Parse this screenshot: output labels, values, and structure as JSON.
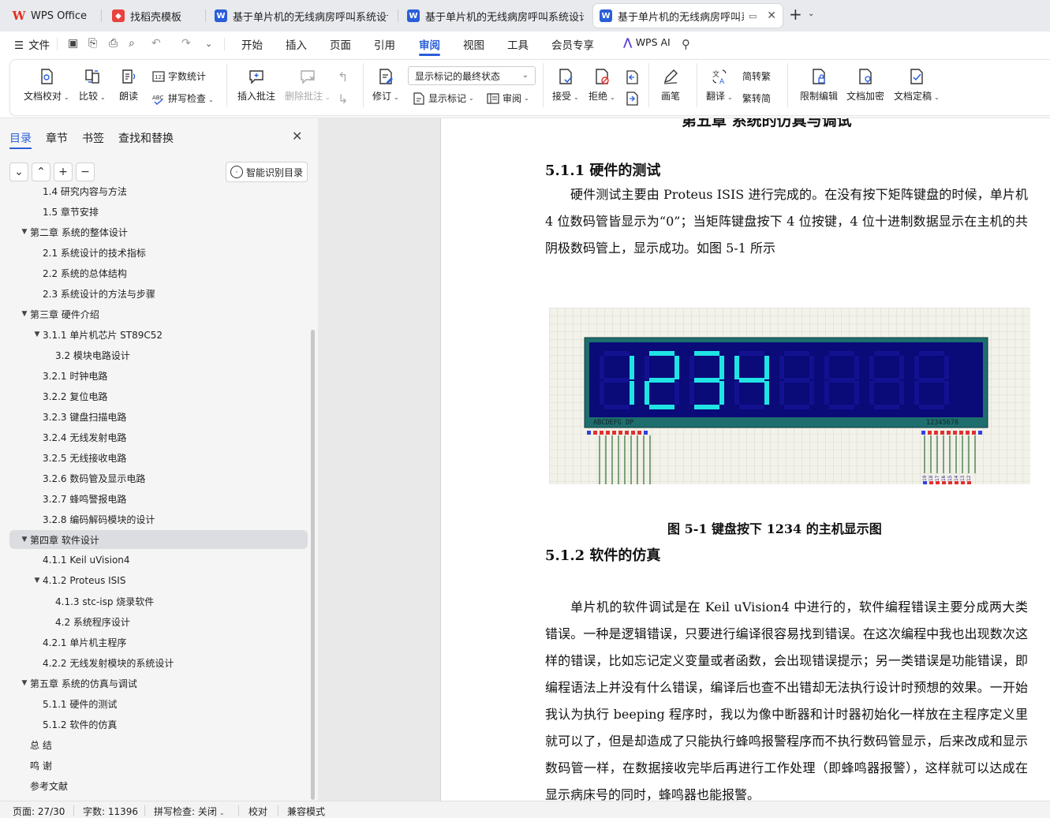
{
  "tabs": [
    {
      "label": "WPS Office",
      "icon": "wps-logo-icon"
    },
    {
      "label": "找稻壳模板",
      "icon": "docer-icon"
    },
    {
      "label": "基于单片机的无线病房呼叫系统设计（",
      "icon": "word-doc-icon"
    },
    {
      "label": "基于单片机的无线病房呼叫系统设计 3",
      "icon": "word-doc-icon"
    },
    {
      "label": "基于单片机的无线病房呼叫系统",
      "icon": "word-doc-icon"
    }
  ],
  "new_tab": "+",
  "menu": {
    "file": "文件",
    "items": [
      "开始",
      "插入",
      "页面",
      "引用",
      "审阅",
      "视图",
      "工具",
      "会员专享"
    ],
    "active": "审阅",
    "wps_ai": "WPS AI"
  },
  "ribbon": {
    "doc_proof": "文档校对",
    "compare": "比较",
    "read_aloud": "朗读",
    "word_count": "字数统计",
    "spell_check": "拼写检查",
    "insert_comment": "插入批注",
    "delete_comment": "删除批注",
    "track": "修订",
    "markup_state": "显示标记的最终状态",
    "show_markup": "显示标记",
    "review": "审阅",
    "accept": "接受",
    "reject": "拒绝",
    "pen": "画笔",
    "translate": "翻译",
    "to_traditional": "简转繁",
    "to_simplified": "繁转简",
    "restrict_edit": "限制编辑",
    "encrypt": "文档加密",
    "finalize": "文档定稿"
  },
  "nav": {
    "tabs": [
      "目录",
      "章节",
      "书签",
      "查找和替换"
    ],
    "smart_toc": "智能识别目录",
    "toc": [
      {
        "label": "1.4  研究内容与方法",
        "level": 2,
        "arrow": ""
      },
      {
        "label": "1.5  章节安排",
        "level": 2,
        "arrow": ""
      },
      {
        "label": "第二章  系统的整体设计",
        "level": 1,
        "arrow": "▼"
      },
      {
        "label": "2.1 系统设计的技术指标",
        "level": 2,
        "arrow": ""
      },
      {
        "label": "2.2 系统的总体结构",
        "level": 2,
        "arrow": ""
      },
      {
        "label": "2.3 系统设计的方法与步骤",
        "level": 2,
        "arrow": ""
      },
      {
        "label": "第三章  硬件介绍",
        "level": 1,
        "arrow": "▼"
      },
      {
        "label": "3.1.1 单片机芯片 ST89C52",
        "level": 2,
        "arrow": "▼"
      },
      {
        "label": "3.2 模块电路设计",
        "level": 3,
        "arrow": ""
      },
      {
        "label": "3.2.1  时钟电路",
        "level": 2,
        "arrow": ""
      },
      {
        "label": "3.2.2  复位电路",
        "level": 2,
        "arrow": ""
      },
      {
        "label": "3.2.3  键盘扫描电路",
        "level": 2,
        "arrow": ""
      },
      {
        "label": "3.2.4  无线发射电路",
        "level": 2,
        "arrow": ""
      },
      {
        "label": "3.2.5 无线接收电路",
        "level": 2,
        "arrow": ""
      },
      {
        "label": "3.2.6 数码管及显示电路",
        "level": 2,
        "arrow": ""
      },
      {
        "label": "3.2.7 蜂鸣警报电路",
        "level": 2,
        "arrow": ""
      },
      {
        "label": "3.2.8  编码解码模块的设计",
        "level": 2,
        "arrow": ""
      },
      {
        "label": "第四章    软件设计",
        "level": 1,
        "arrow": "▼",
        "selected": true
      },
      {
        "label": "4.1.1 Keil uVision4",
        "level": 2,
        "arrow": ""
      },
      {
        "label": "4.1.2 Proteus ISIS",
        "level": 2,
        "arrow": "▼"
      },
      {
        "label": "4.1.3 stc-isp 烧录软件",
        "level": 3,
        "arrow": ""
      },
      {
        "label": "4.2  系统程序设计",
        "level": 3,
        "arrow": ""
      },
      {
        "label": "4.2.1 单片机主程序",
        "level": 2,
        "arrow": ""
      },
      {
        "label": "4.2.2 无线发射模块的系统设计",
        "level": 2,
        "arrow": ""
      },
      {
        "label": "第五章  系统的仿真与调试",
        "level": 1,
        "arrow": "▼"
      },
      {
        "label": "5.1.1 硬件的测试",
        "level": 2,
        "arrow": ""
      },
      {
        "label": "5.1.2  软件的仿真",
        "level": 2,
        "arrow": ""
      },
      {
        "label": "总    结",
        "level": 1,
        "arrow": ""
      },
      {
        "label": "鸣    谢",
        "level": 1,
        "arrow": ""
      },
      {
        "label": "参考文献",
        "level": 1,
        "arrow": ""
      }
    ]
  },
  "document": {
    "chapter_title": "第五章  系统的仿真与调试",
    "h_511": "5.1.1 硬件的测试",
    "p_511": "硬件测试主要由 Proteus ISIS 进行完成的。在没有按下矩阵键盘的时候，单片机 4 位数码管皆显示为“0”；当矩阵键盘按下 4 位按键，4 位十进制数据显示在主机的共阴极数码管上，显示成功。如图 5-1 所示",
    "figure_digits": "1234",
    "figure_left_pins": "ABCDEFG DP",
    "figure_right_pins": "12345678",
    "figure_pin_numbers": [
      "19",
      "18",
      "17",
      "16",
      "15",
      "14",
      "13",
      "12"
    ],
    "caption": "图 5-1  键盘按下 1234 的主机显示图",
    "h_512": "5.1.2  软件的仿真",
    "p_512": "单片机的软件调试是在 Keil uVision4 中进行的，软件编程错误主要分成两大类错误。一种是逻辑错误，只要进行编译很容易找到错误。在这次编程中我也出现数次这样的错误，比如忘记定义变量或者函数，会出现错误提示；另一类错误是功能错误，即编程语法上并没有什么错误，编译后也查不出错却无法执行设计时预想的效果。一开始我认为执行 beeping 程序时，我以为像中断器和计时器初始化一样放在主程序定义里就可以了，但是却造成了只能执行蜂鸣报警程序而不执行数码管显示，后来改成和显示数码管一样，在数据接收完毕后再进行工作处理（即蜂鸣器报警），这样就可以达成在显示病床号的同时，蜂鸣器也能报警。"
  },
  "status": {
    "page": "页面: 27/30",
    "words": "字数: 11396",
    "spell": "拼写检查: 关闭",
    "proof": "校对",
    "compat": "兼容模式"
  },
  "colors": {
    "accent": "#2b5fd9",
    "lcd_bg": "#0a0a78",
    "lcd_digit": "#20e4e4",
    "lcd_frame": "#1e6e6e"
  }
}
